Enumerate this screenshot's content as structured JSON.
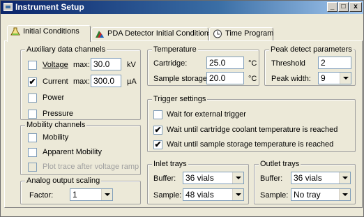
{
  "window": {
    "title": "Instrument Setup",
    "minimize_glyph": "_",
    "maximize_glyph": "□",
    "close_glyph": "x"
  },
  "tabs": [
    {
      "label": "Initial Conditions",
      "icon": "flask-icon"
    },
    {
      "label": "PDA Detector Initial Conditions",
      "icon": "spectrum-icon"
    },
    {
      "label": "Time Program",
      "icon": "clock-icon"
    }
  ],
  "auxiliary": {
    "title": "Auxiliary data channels",
    "voltage": {
      "label": "Voltage",
      "checked": false,
      "max_label": "max:",
      "value": "30.0",
      "unit": "kV"
    },
    "current": {
      "label": "Current",
      "checked": true,
      "max_label": "max:",
      "value": "300.0",
      "unit": "µA"
    },
    "power": {
      "label": "Power",
      "checked": false
    },
    "pressure": {
      "label": "Pressure",
      "checked": false
    }
  },
  "mobility": {
    "title": "Mobility channels",
    "mobility": {
      "label": "Mobility",
      "checked": false
    },
    "apparent": {
      "label": "Apparent Mobility",
      "checked": false
    },
    "plot_trace": {
      "label": "Plot trace after voltage ramp",
      "checked": false,
      "enabled": false
    }
  },
  "analog": {
    "title": "Analog output scaling",
    "factor_label": "Factor:",
    "factor_value": "1"
  },
  "temperature": {
    "title": "Temperature",
    "cartridge_label": "Cartridge:",
    "cartridge_value": "25.0",
    "cartridge_unit": "°C",
    "storage_label": "Sample storage:",
    "storage_value": "20.0",
    "storage_unit": "°C"
  },
  "peak": {
    "title": "Peak detect parameters",
    "threshold_label": "Threshold",
    "threshold_value": "2",
    "width_label": "Peak width:",
    "width_value": "9"
  },
  "trigger": {
    "title": "Trigger settings",
    "external": {
      "label": "Wait for external trigger",
      "checked": false
    },
    "coolant": {
      "label": "Wait until cartridge coolant temperature is reached",
      "checked": true
    },
    "storage": {
      "label": "Wait until sample storage temperature is reached",
      "checked": true
    }
  },
  "inlet": {
    "title": "Inlet trays",
    "buffer_label": "Buffer:",
    "buffer_value": "36 vials",
    "sample_label": "Sample:",
    "sample_value": "48 vials"
  },
  "outlet": {
    "title": "Outlet trays",
    "buffer_label": "Buffer:",
    "buffer_value": "36 vials",
    "sample_label": "Sample:",
    "sample_value": "No tray"
  },
  "check_mark": "✔"
}
